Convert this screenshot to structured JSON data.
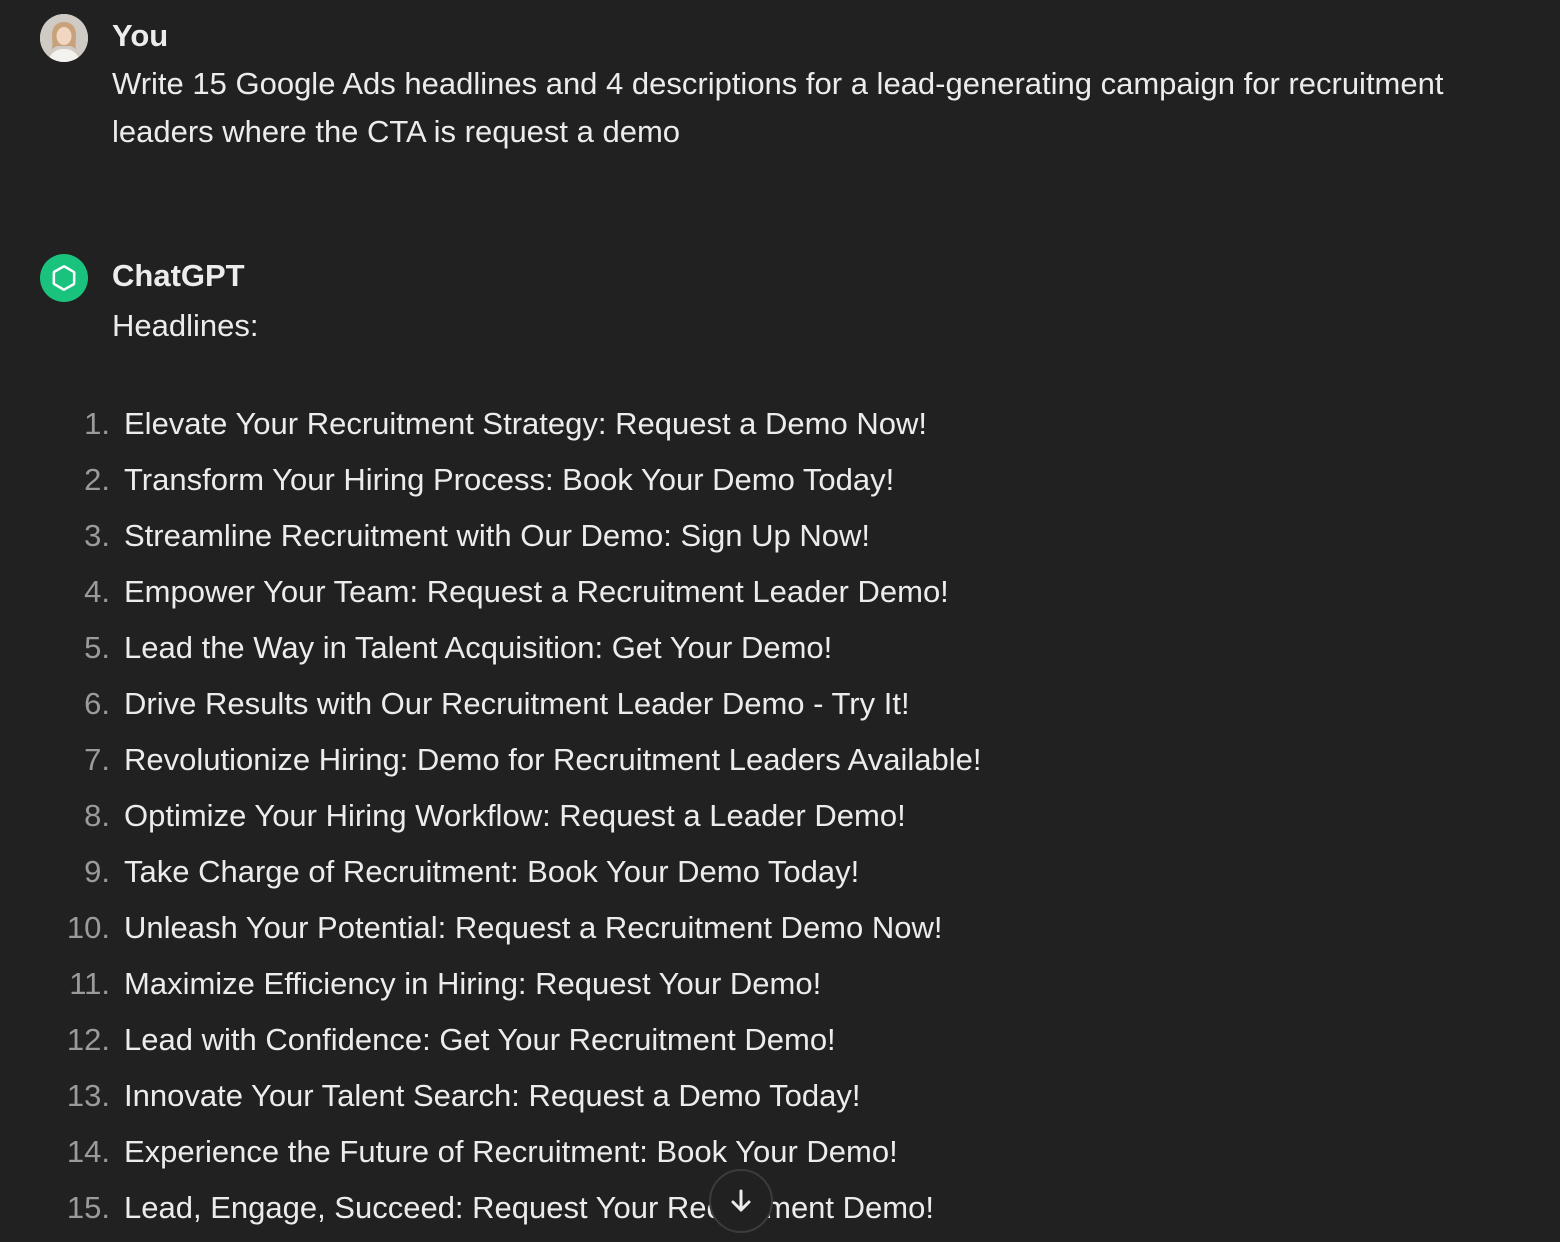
{
  "conversation": {
    "user_message": {
      "author": "You",
      "avatar_icon": "user-avatar-photo",
      "text_line1": "Write 15 Google Ads headlines and 4 descriptions for a lead-generating campaign for recruitment",
      "text_line2": "leaders where the CTA is request a demo"
    },
    "assistant_message": {
      "author": "ChatGPT",
      "avatar_icon": "openai-logo-icon",
      "avatar_color": "#19c37d",
      "section_label": "Headlines:",
      "headlines": [
        {
          "num": "1.",
          "text": "Elevate Your Recruitment Strategy: Request a Demo Now!"
        },
        {
          "num": "2.",
          "text": "Transform Your Hiring Process: Book Your Demo Today!"
        },
        {
          "num": "3.",
          "text": "Streamline Recruitment with Our Demo: Sign Up Now!"
        },
        {
          "num": "4.",
          "text": "Empower Your Team: Request a Recruitment Leader Demo!"
        },
        {
          "num": "5.",
          "text": "Lead the Way in Talent Acquisition: Get Your Demo!"
        },
        {
          "num": "6.",
          "text": "Drive Results with Our Recruitment Leader Demo - Try It!"
        },
        {
          "num": "7.",
          "text": "Revolutionize Hiring: Demo for Recruitment Leaders Available!"
        },
        {
          "num": "8.",
          "text": "Optimize Your Hiring Workflow: Request a Leader Demo!"
        },
        {
          "num": "9.",
          "text": "Take Charge of Recruitment: Book Your Demo Today!"
        },
        {
          "num": "10.",
          "text": "Unleash Your Potential: Request a Recruitment Demo Now!"
        },
        {
          "num": "11.",
          "text": "Maximize Efficiency in Hiring: Request Your Demo!"
        },
        {
          "num": "12.",
          "text": "Lead with Confidence: Get Your Recruitment Demo!"
        },
        {
          "num": "13.",
          "text": "Innovate Your Talent Search: Request a Demo Today!"
        },
        {
          "num": "14.",
          "text": "Experience the Future of Recruitment: Book Your Demo!"
        },
        {
          "num": "15.",
          "text": "Lead, Engage, Succeed: Request Your Recruitment Demo!"
        }
      ]
    },
    "scroll_button": {
      "icon": "arrow-down-icon"
    }
  },
  "colors": {
    "background": "#212121",
    "text": "#ececec",
    "muted_text": "#9b9b9b",
    "accent": "#19c37d"
  }
}
